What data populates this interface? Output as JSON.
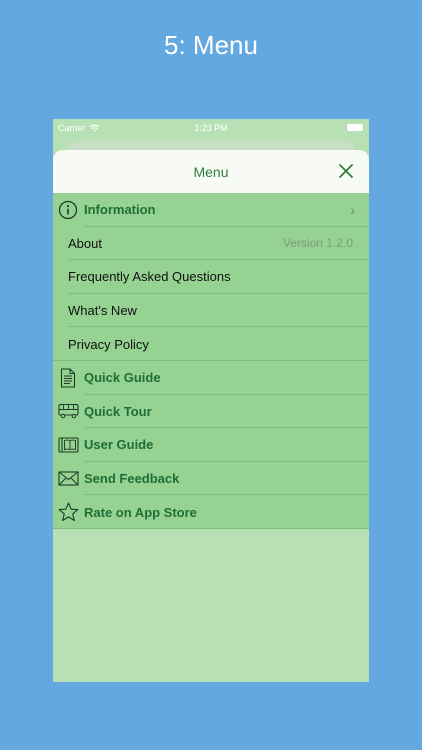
{
  "caption": "5: Menu",
  "status_bar": {
    "carrier": "Carrier",
    "time": "1:23 PM"
  },
  "sheet": {
    "title": "Menu"
  },
  "information": {
    "label": "Information",
    "items": [
      {
        "label": "About",
        "detail": "Version 1.2.0"
      },
      {
        "label": "Frequently Asked Questions"
      },
      {
        "label": "What's New"
      },
      {
        "label": "Privacy Policy"
      }
    ]
  },
  "sections": [
    {
      "label": "Quick Guide",
      "icon": "document-icon"
    },
    {
      "label": "Quick Tour",
      "icon": "bus-icon"
    },
    {
      "label": "User Guide",
      "icon": "book-icon"
    },
    {
      "label": "Send Feedback",
      "icon": "envelope-icon"
    },
    {
      "label": "Rate on App Store",
      "icon": "star-icon"
    }
  ],
  "colors": {
    "background": "#63a8e0",
    "accent": "#1f6e37",
    "menu_row": "#96d392",
    "app_background": "#b7e1b5"
  }
}
